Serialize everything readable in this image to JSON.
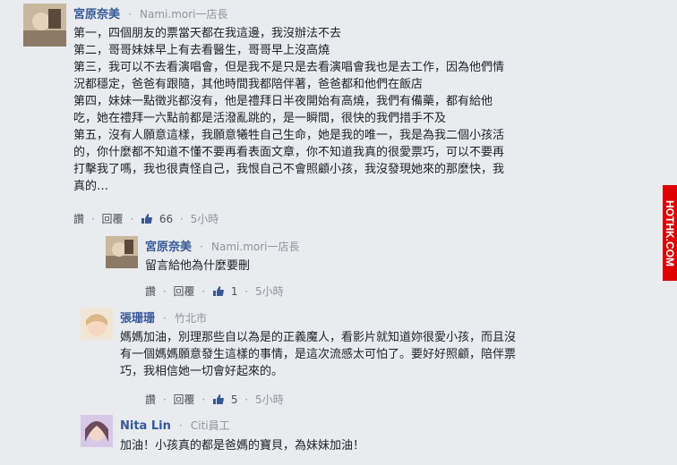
{
  "comments": [
    {
      "name": "宮原奈美",
      "meta": "Nami.mori一店長",
      "text": "第一，四個朋友的票當天都在我這邊，我沒辦法不去\n第二，哥哥妹妹早上有去看醫生，哥哥早上沒高燒\n第三，我可以不去看演唱會，但是我不是只是去看演唱會我也是去工作，因為他們情\n況都穩定，爸爸有跟隨，其他時間我都陪伴著，爸爸都和他們在飯店\n第四，妹妹一點徵兆都沒有，他是禮拜日半夜開始有高燒，我們有備藥，都有給他\n吃，她在禮拜一六點前都是活潑亂跳的，是一瞬間，很快的我們措手不及\n第五，沒有人願意這樣，我願意犧牲自己生命，她是我的唯一，我是為我二個小孩活\n的，你什麼都不知道不懂不要再看表面文章，你不知道我真的很愛票巧，可以不要再\n打擊我了嗎，我也很責怪自己，我恨自己不會照顧小孩，我沒發現她來的那麼快，我\n真的…",
      "like_label": "讚",
      "reply_label": "回覆",
      "like_count": "66",
      "time": "5小時"
    },
    {
      "name": "宮原奈美",
      "meta": "Nami.mori一店長",
      "text": "留言給他為什麼要刪",
      "like_label": "讚",
      "reply_label": "回覆",
      "like_count": "1",
      "time": "5小時"
    },
    {
      "name": "張珊珊",
      "meta": "竹北市",
      "text": "媽媽加油，別理那些自以為是的正義魔人，看影片就知道妳很愛小孩，而且沒\n有一個媽媽願意發生這樣的事情，是這次流感太可怕了。要好好照顧，陪伴票\n巧，我相信她一切會好起來的。",
      "like_label": "讚",
      "reply_label": "回覆",
      "like_count": "5",
      "time": "5小時"
    },
    {
      "name": "Nita Lin",
      "meta": "Citi員工",
      "text": "加油！小孩真的都是爸媽的寶貝，為妹妹加油！"
    }
  ],
  "separator": "·",
  "watermark": "HOTHK.COM",
  "colors": {
    "name": "#365899",
    "meta": "#90949c",
    "background": "#e9ebee",
    "watermark": "#e00000"
  }
}
